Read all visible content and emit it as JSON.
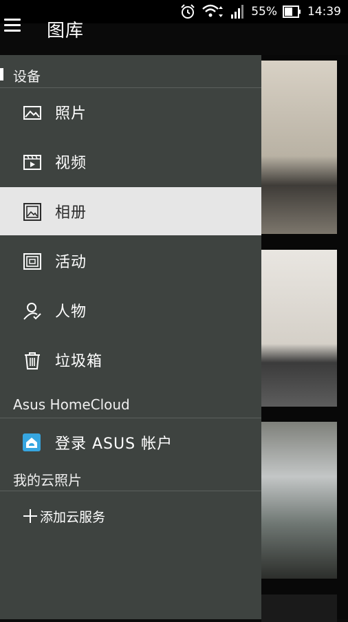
{
  "status_bar": {
    "battery": "55%",
    "time": "14:39"
  },
  "app_bar": {
    "title": "图库"
  },
  "drawer": {
    "device_section": "设备",
    "items": [
      {
        "label": "照片",
        "icon": "photo-icon"
      },
      {
        "label": "视频",
        "icon": "video-icon"
      },
      {
        "label": "相册",
        "icon": "album-icon",
        "selected": true
      },
      {
        "label": "活动",
        "icon": "event-icon"
      },
      {
        "label": "人物",
        "icon": "person-icon"
      },
      {
        "label": "垃圾箱",
        "icon": "trash-icon"
      }
    ],
    "homecloud_section": "Asus HomeCloud",
    "login_label": "登录 ASUS 帐户",
    "cloud_section": "我的云照片",
    "add_cloud_label": "添加云服务"
  },
  "colors": {
    "drawer_bg": "#3e4340",
    "selected_bg": "#e6e6e6",
    "login_icon": "#36a6e0"
  }
}
